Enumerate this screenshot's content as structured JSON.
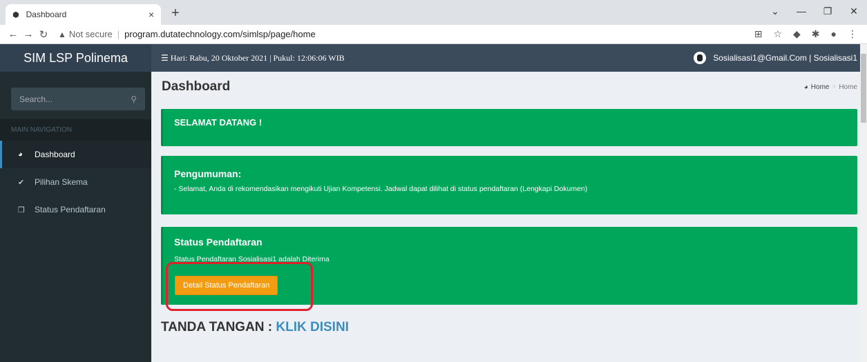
{
  "browser": {
    "tab_title": "Dashboard",
    "tab_close": "×",
    "new_tab": "+",
    "not_secure": "Not secure",
    "url": "program.dutatechnology.com/simlsp/page/home"
  },
  "app": {
    "brand": "SIM LSP Polinema",
    "datetime": "Hari: Rabu, 20 Oktober 2021 | Pukul: 12:06:06 WIB",
    "user": "Sosialisasi1@Gmail.Com | Sosialisasi1"
  },
  "sidebar": {
    "search_placeholder": "Search...",
    "nav_header": "MAIN NAVIGATION",
    "items": [
      {
        "label": "Dashboard",
        "icon": "dashboard-icon"
      },
      {
        "label": "Pilihan Skema",
        "icon": "check-circle-icon"
      },
      {
        "label": "Status Pendaftaran",
        "icon": "copy-icon"
      }
    ]
  },
  "content": {
    "page_title": "Dashboard",
    "breadcrumb": {
      "home": "Home",
      "current": "Home"
    },
    "welcome": "SELAMAT DATANG !",
    "announcement_title": "Pengumuman:",
    "announcement_text": "- Selamat, Anda di rekomendasikan mengikuti Ujian Kompetensi. Jadwal dapat dilihat di status pendaftaran (Lengkapi Dokumen)",
    "status_title": "Status Pendaftaran",
    "status_text": "Status Pendaftaran Sosialisasi1 adalah Diterima",
    "detail_button": "Detail Status Pendaftaran",
    "ttd_label": "TANDA TANGAN : ",
    "ttd_link": "KLIK DISINI"
  },
  "colors": {
    "accent_green": "#00a65a",
    "button_orange": "#f39c12",
    "header_bg": "#3c4b5c",
    "sidebar_bg": "#222d32",
    "highlight_red": "#e0202a"
  }
}
